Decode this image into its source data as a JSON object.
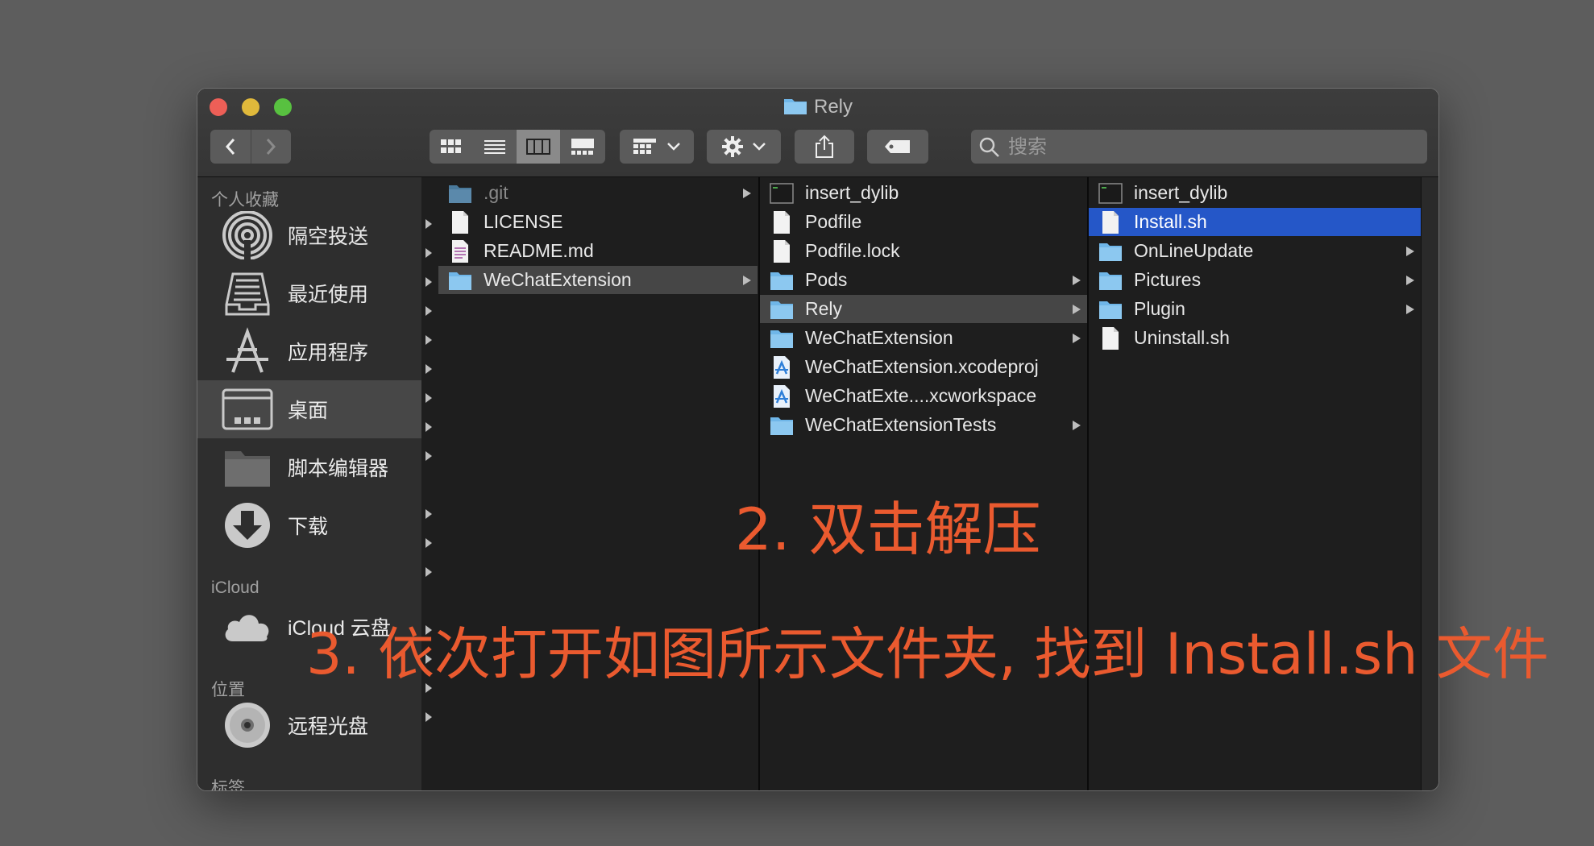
{
  "window": {
    "title": "Rely"
  },
  "toolbar": {
    "back": "back",
    "forward": "forward",
    "views": [
      "icon-view",
      "list-view",
      "column-view",
      "gallery-view"
    ],
    "group": "group-by",
    "action": "action",
    "share": "share",
    "tag": "tag"
  },
  "search": {
    "placeholder": "搜索"
  },
  "sidebar": {
    "sections": [
      "个人收藏",
      "iCloud",
      "位置",
      "标签"
    ],
    "favorites": [
      "隔空投送",
      "最近使用",
      "应用程序",
      "桌面",
      "脚本编辑器",
      "下载"
    ],
    "icloud": [
      "iCloud 云盘"
    ],
    "locations": [
      "远程光盘"
    ]
  },
  "columns": [
    {
      "items": [
        ".git",
        "LICENSE",
        "README.md",
        "WeChatExtension"
      ]
    },
    {
      "items": [
        "insert_dylib",
        "Podfile",
        "Podfile.lock",
        "Pods",
        "Rely",
        "WeChatExtension",
        "WeChatExtension.xcodeproj",
        "WeChatExte....xcworkspace",
        "WeChatExtensionTests"
      ]
    },
    {
      "items": [
        "insert_dylib",
        "Install.sh",
        "OnLineUpdate",
        "Pictures",
        "Plugin",
        "Uninstall.sh"
      ]
    }
  ],
  "annotations": {
    "step2": "2. 双击解压",
    "step3": "3. 依次打开如图所示文件夹, 找到 Install.sh 文件"
  },
  "colors": {
    "accent": "#2557c8",
    "annotation": "#ea5a2f",
    "folder": "#6fb6e8"
  }
}
